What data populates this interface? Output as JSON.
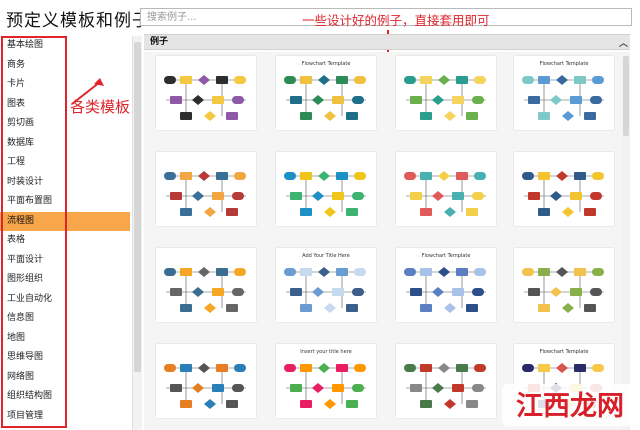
{
  "title": "预定义模板和例子",
  "search": {
    "placeholder": "搜索例子..."
  },
  "sidebar": {
    "items": [
      {
        "label": "基本绘图"
      },
      {
        "label": "商务"
      },
      {
        "label": "卡片"
      },
      {
        "label": "图表"
      },
      {
        "label": "剪切画"
      },
      {
        "label": "数据库"
      },
      {
        "label": "工程"
      },
      {
        "label": "时装设计"
      },
      {
        "label": "平面布置图"
      },
      {
        "label": "流程图",
        "active": true
      },
      {
        "label": "表格"
      },
      {
        "label": "平面设计"
      },
      {
        "label": "图形组织"
      },
      {
        "label": "工业自动化"
      },
      {
        "label": "信息图"
      },
      {
        "label": "地图"
      },
      {
        "label": "思维导图"
      },
      {
        "label": "网络图"
      },
      {
        "label": "组织结构图"
      },
      {
        "label": "项目管理"
      }
    ]
  },
  "annotations": {
    "left": "各类模板",
    "top": "一些设计好的例子，直接套用即可"
  },
  "main": {
    "section": "例子",
    "collapse_icon": "chevron-up-icon"
  },
  "thumbnails": {
    "items": [
      {
        "label": ""
      },
      {
        "label": "Flowchart Template"
      },
      {
        "label": ""
      },
      {
        "label": "Flowchart Template"
      },
      {
        "label": ""
      },
      {
        "label": ""
      },
      {
        "label": ""
      },
      {
        "label": ""
      },
      {
        "label": ""
      },
      {
        "label": "Add Your Title Here"
      },
      {
        "label": "Flowchart Template"
      },
      {
        "label": ""
      },
      {
        "label": ""
      },
      {
        "label": "Insert your title here"
      },
      {
        "label": ""
      },
      {
        "label": "Flowchart Template"
      }
    ]
  },
  "watermark": {
    "text": "江西龙网",
    "accent": "#d8202a"
  },
  "colors": {
    "active": "#f7a64a",
    "annotation": "#e0242b"
  }
}
